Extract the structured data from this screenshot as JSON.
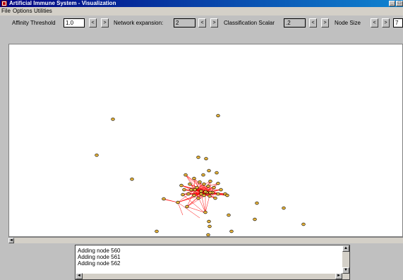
{
  "window": {
    "title": "Artificial Immune System - Visualization"
  },
  "menu": {
    "items": [
      "File",
      "Options",
      "Utilities"
    ]
  },
  "controls": {
    "affinity_label": "Affinity Threshold",
    "affinity_value": "1.0",
    "network_label": "Network expansion:",
    "network_value": "2",
    "classification_label": "Classification Scalar",
    "classification_value": ".2",
    "nodesize_label": "Node Size",
    "nodesize_value": "7",
    "dec_glyph": "<",
    "inc_glyph": ">"
  },
  "log": {
    "lines": [
      "Adding node 560",
      "Adding node 561",
      "Adding node 562"
    ]
  },
  "colors": {
    "node_fill": "#e8b43a",
    "edge": "#ff0000",
    "canvas_bg": "#ffffff",
    "titlebar": "#000080"
  }
}
